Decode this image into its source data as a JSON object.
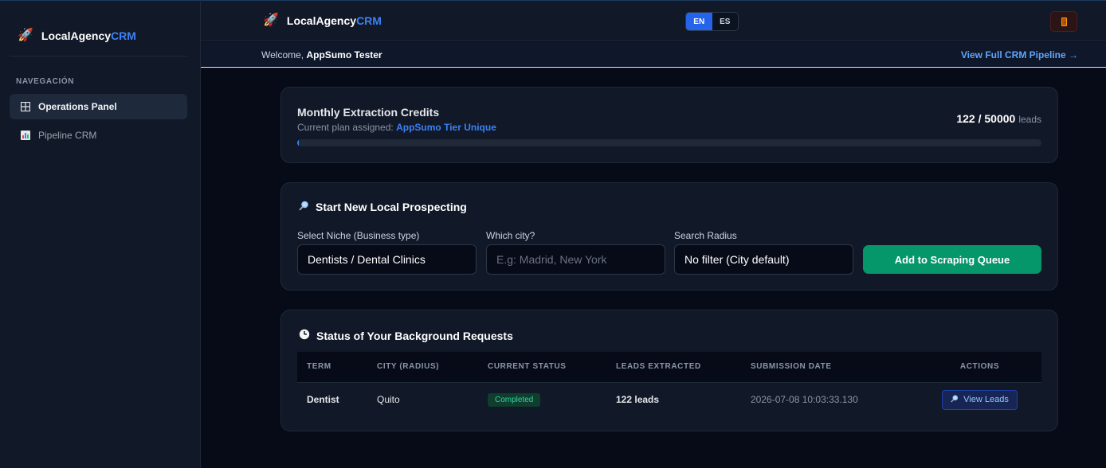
{
  "app": {
    "brand_main": "LocalAgency",
    "brand_accent": "CRM"
  },
  "sidebar": {
    "section_label": "NAVEGACIÓN",
    "items": [
      {
        "label": "Operations Panel",
        "icon": "grid-icon",
        "active": true
      },
      {
        "label": "Pipeline CRM",
        "icon": "bar-chart-icon",
        "active": false
      }
    ]
  },
  "topbar": {
    "lang_en": "EN",
    "lang_es": "ES",
    "logout_icon": "door-icon"
  },
  "welcome": {
    "prefix": "Welcome,",
    "user": "AppSumo Tester",
    "pipeline_link": "View Full CRM Pipeline →"
  },
  "credits": {
    "title": "Monthly Extraction Credits",
    "plan_prefix": "Current plan assigned:",
    "plan_name": "AppSumo Tier Unique",
    "count": "122 / 50000",
    "unit": "leads",
    "progress_fraction": 0.00244
  },
  "prospecting": {
    "title": "Start New Local Prospecting",
    "icon": "magnifier-icon",
    "niche_label": "Select Niche (Business type)",
    "niche_value": "Dentists / Dental Clinics",
    "city_label": "Which city?",
    "city_placeholder": "E.g: Madrid, New York",
    "radius_label": "Search Radius",
    "radius_value": "No filter (City default)",
    "submit_label": "Add to Scraping Queue"
  },
  "requests": {
    "title": "Status of Your Background Requests",
    "icon": "clock-icon",
    "columns": [
      "TERM",
      "CITY (RADIUS)",
      "CURRENT STATUS",
      "LEADS EXTRACTED",
      "SUBMISSION DATE",
      "ACTIONS"
    ],
    "rows": [
      {
        "term": "Dentist",
        "city": "Quito",
        "status": "Completed",
        "leads": "122 leads",
        "date": "2026-07-08 10:03:33.130",
        "action": "View Leads"
      }
    ]
  },
  "colors": {
    "accent": "#3b82f6",
    "success": "#059669",
    "background": "#070b18"
  }
}
